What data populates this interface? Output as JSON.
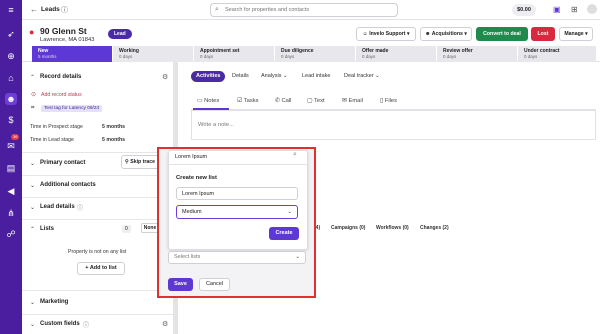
{
  "rail": {
    "notification_count": "36"
  },
  "topbar": {
    "back_label": "Leads",
    "search_placeholder": "Search for properties and contacts",
    "balance": "$0.00"
  },
  "header": {
    "address_line1": "90 Glenn St",
    "address_line2": "Lawrence, MA 01843",
    "status_pill": "Lead",
    "assignee": "Invelo Support",
    "acquisitions": "Acquisitions",
    "convert": "Convert to deal",
    "lost": "Lost",
    "manage": "Manage"
  },
  "stages": [
    {
      "name": "New",
      "days": "5 months"
    },
    {
      "name": "Working",
      "days": "0 days"
    },
    {
      "name": "Appointment set",
      "days": "0 days"
    },
    {
      "name": "Due diligence",
      "days": "0 days"
    },
    {
      "name": "Offer made",
      "days": "0 days"
    },
    {
      "name": "Review offer",
      "days": "0 days"
    },
    {
      "name": "Under contract",
      "days": "0 days"
    }
  ],
  "sidebar": {
    "record_details": "Record details",
    "add_record_status": "Add record status",
    "tag": "Test tag for Latency 09/24",
    "prospect_stage_label": "Time in Prospect stage",
    "prospect_stage_value": "5 months",
    "lead_stage_label": "Time in Lead stage",
    "lead_stage_value": "5 months",
    "primary_contact": "Primary contact",
    "skip_trace": "Skip trace",
    "additional_contacts": "Additional contacts",
    "lead_details": "Lead details",
    "lists": "Lists",
    "lists_count": "0",
    "none_label": "None",
    "not_on_list": "Property is not on any list",
    "add_to_list": "Add to list",
    "marketing": "Marketing",
    "custom_fields": "Custom fields"
  },
  "main": {
    "tabs": [
      "Activities",
      "Details",
      "Analysis",
      "Lead intake",
      "Deal tracker"
    ],
    "subtabs": [
      "Notes",
      "Tasks",
      "Call",
      "Text",
      "Email",
      "Files"
    ],
    "note_placeholder": "Write a note...",
    "counts": [
      "(4)",
      "Campaigns (0)",
      "Workflows (0)",
      "Changes (2)"
    ]
  },
  "popup": {
    "search_value": "Lorem Ipsum",
    "create_new_list": "Create new list",
    "list_name": "Lorem Ipsum",
    "priority": "Medium",
    "create_btn": "Create",
    "select_lists_placeholder": "Select lists",
    "save_btn": "Save",
    "cancel_btn": "Cancel"
  }
}
